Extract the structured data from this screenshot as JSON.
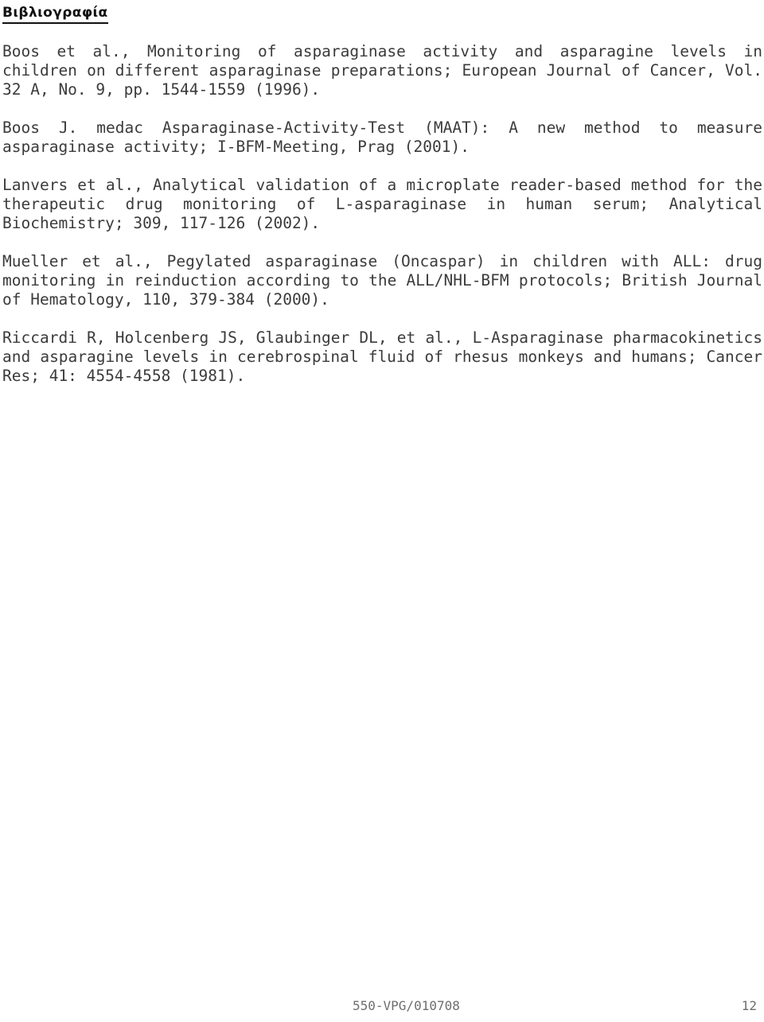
{
  "document": {
    "title": "Βιβλιογραφία",
    "references": [
      "Boos et al., Monitoring of asparaginase activity and asparagine levels in children on different asparaginase preparations; European Journal of Cancer, Vol. 32 A, No. 9, pp. 1544-1559 (1996).",
      "Boos J. medac Asparaginase-Activity-Test (MAAT): A new method to measure asparaginase activity; I-BFM-Meeting, Prag (2001).",
      "Lanvers et al., Analytical validation of a microplate reader-based method for the therapeutic drug monitoring of L-asparaginase in human serum; Analytical Biochemistry; 309, 117-126 (2002).",
      "Mueller et al., Pegylated asparaginase (Oncaspar) in children with ALL: drug monitoring in reinduction according to the ALL/NHL-BFM protocols; British Journal of Hematology, 110, 379-384 (2000).",
      "Riccardi R, Holcenberg JS, Glaubinger DL, et al., L-Asparaginase pharmacokinetics and asparagine levels in cerebrospinal fluid of rhesus monkeys and humans; Cancer Res; 41: 4554-4558 (1981)."
    ]
  },
  "footer": {
    "document_code": "550-VPG/010708",
    "page_number": "12"
  },
  "colors": {
    "page_background": "#ffffff",
    "body_text": "#3b3b3b",
    "title_text": "#111111",
    "footer_text": "#6e6e6e"
  }
}
